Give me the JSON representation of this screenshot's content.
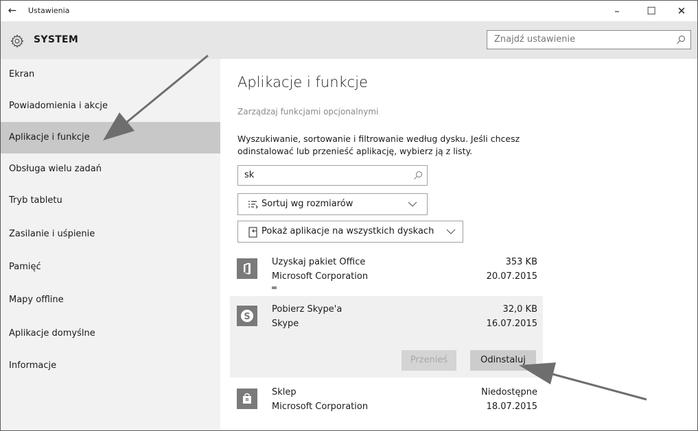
{
  "window": {
    "title": "Ustawienia",
    "back_glyph": "←",
    "minimize_glyph": "–",
    "maximize_glyph": "☐",
    "close_glyph": "✕"
  },
  "header": {
    "title": "SYSTEM",
    "search_placeholder": "Znajdź ustawienie"
  },
  "sidebar": {
    "items": [
      {
        "label": "Ekran"
      },
      {
        "label": "Powiadomienia i akcje"
      },
      {
        "label": "Aplikacje i funkcje",
        "active": true
      },
      {
        "label": "Obsługa wielu zadań"
      },
      {
        "label": "Tryb tabletu"
      },
      {
        "label": "Zasilanie i uśpienie"
      },
      {
        "label": "Pamięć"
      },
      {
        "label": "Mapy offline"
      },
      {
        "label": "Aplikacje domyślne"
      },
      {
        "label": "Informacje"
      }
    ]
  },
  "main": {
    "title": "Aplikacje i funkcje",
    "manage_link": "Zarządzaj funkcjami opcjonalnymi",
    "description": "Wyszukiwanie, sortowanie i filtrowanie według dysku. Jeśli chcesz odinstalować lub przenieść aplikację, wybierz ją z listy.",
    "filter_value": "sk",
    "sort_label": "Sortuj wg rozmiarów",
    "drives_label": "Pokaż aplikacje na wszystkich dyskach",
    "apps": [
      {
        "name": "Uzyskaj pakiet Office",
        "publisher": "Microsoft Corporation",
        "size": "353 KB",
        "date": "20.07.2015",
        "icon": "office-icon"
      },
      {
        "name": "Pobierz Skype'a",
        "publisher": "Skype",
        "size": "32,0 KB",
        "date": "16.07.2015",
        "icon": "skype-icon",
        "selected": true
      },
      {
        "name": "Sklep",
        "publisher": "Microsoft Corporation",
        "size": "Niedostępne",
        "date": "18.07.2015",
        "icon": "store-icon"
      }
    ],
    "move_button": "Przenieś",
    "uninstall_button": "Odinstaluj"
  },
  "colors": {
    "header_bg": "#e6e6e6",
    "sidebar_bg": "#f2f2f2",
    "active_item_bg": "#c8c8c8",
    "tile_bg": "#7a7a7a",
    "selected_app_bg": "#f0f0f0",
    "arrow": "#6e6e6e"
  }
}
